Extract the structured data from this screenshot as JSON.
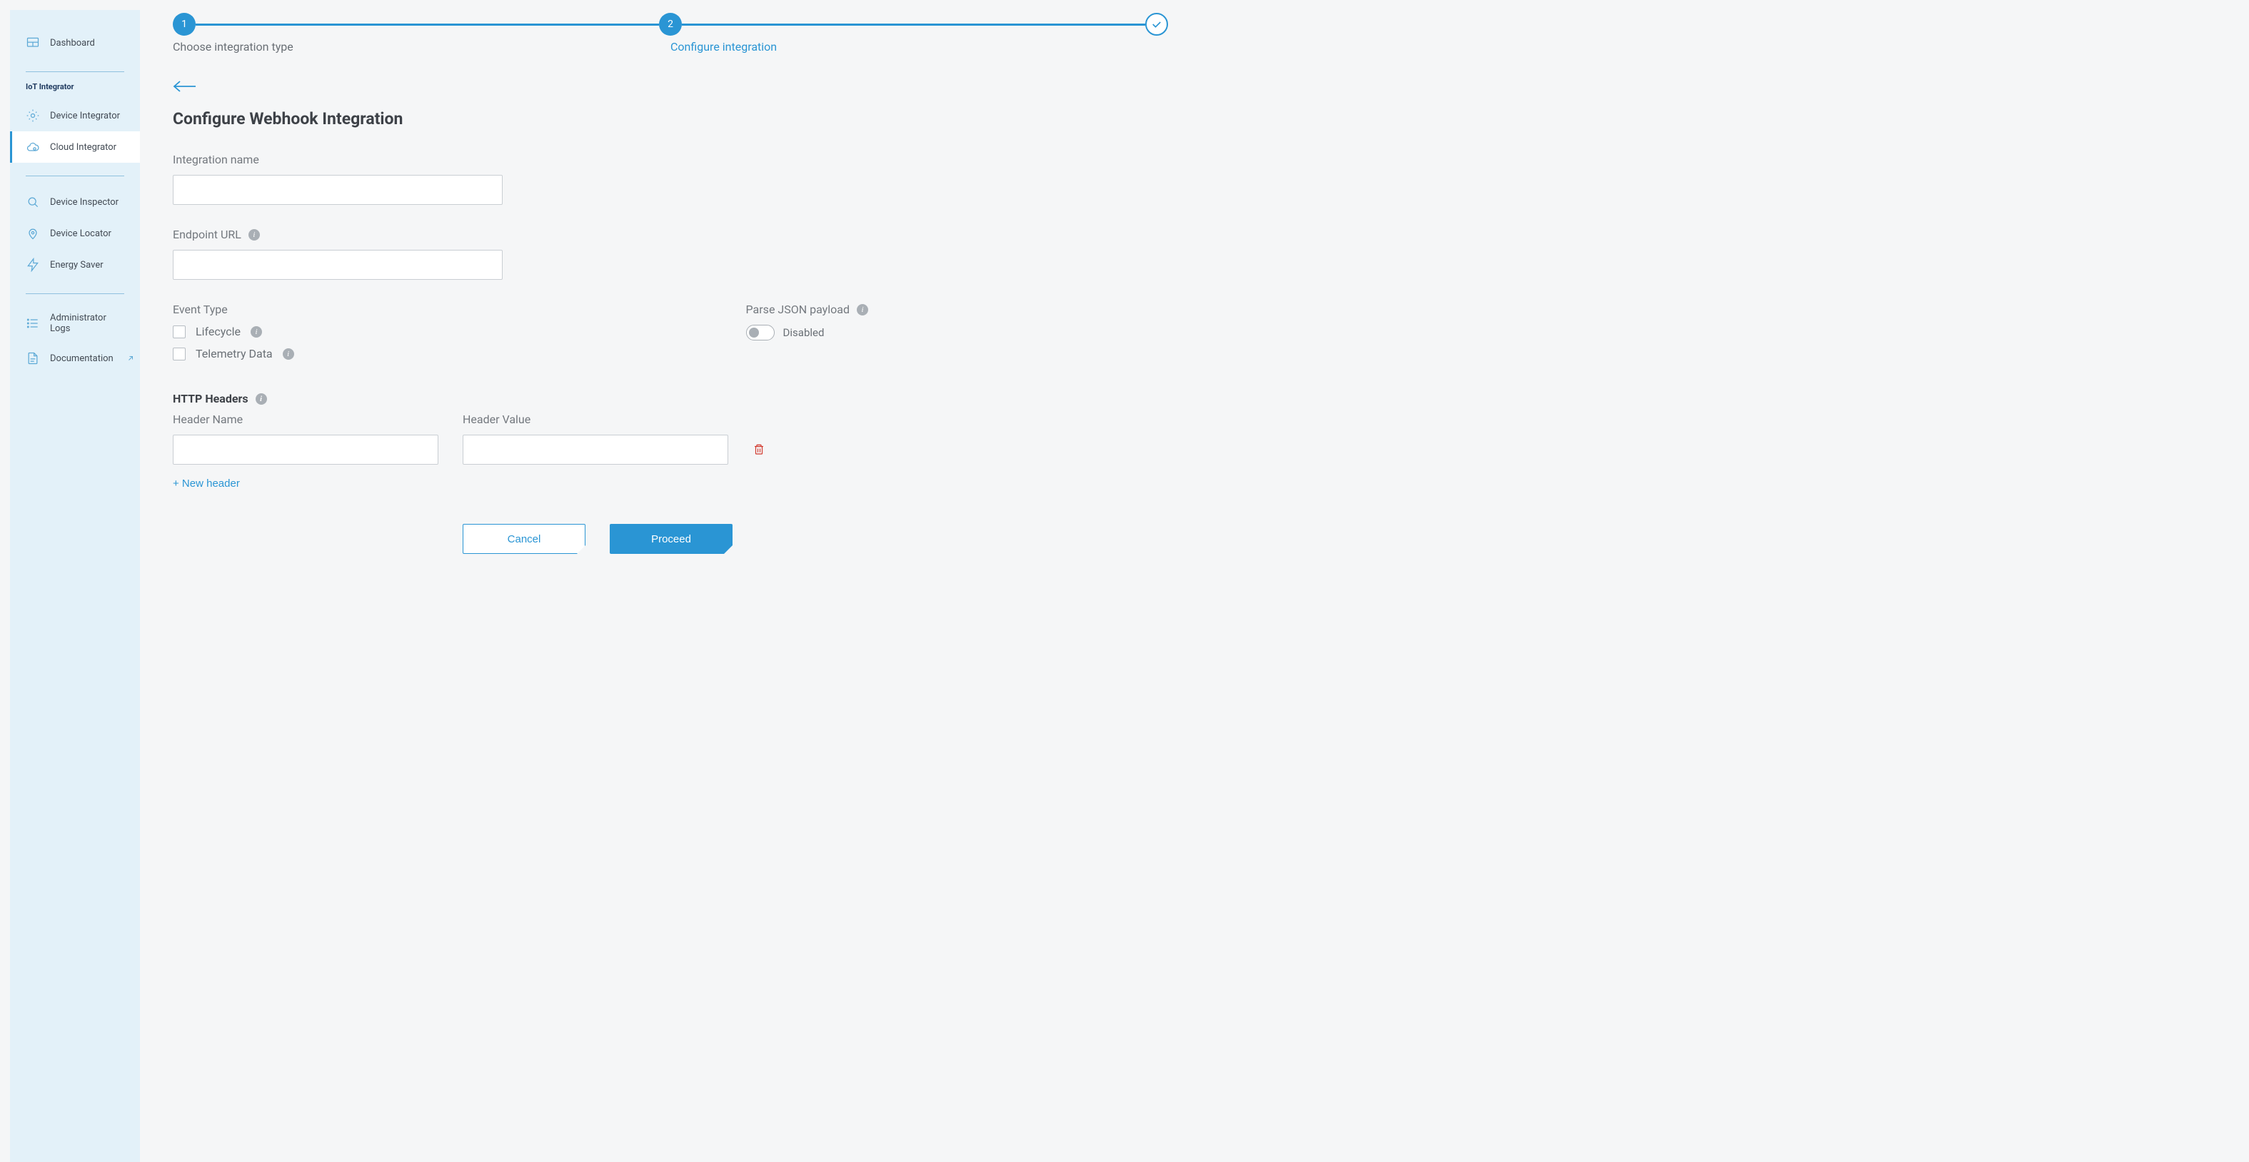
{
  "sidebar": {
    "dashboard": "Dashboard",
    "section_title": "IoT Integrator",
    "device_integrator": "Device Integrator",
    "cloud_integrator": "Cloud Integrator",
    "device_inspector": "Device Inspector",
    "device_locator": "Device Locator",
    "energy_saver": "Energy Saver",
    "admin_logs": "Administrator Logs",
    "documentation": "Documentation"
  },
  "stepper": {
    "step1_number": "1",
    "step2_number": "2",
    "step1_label": "Choose integration type",
    "step2_label": "Configure integration"
  },
  "page": {
    "title": "Configure Webhook Integration"
  },
  "fields": {
    "integration_name_label": "Integration name",
    "integration_name_value": "",
    "endpoint_url_label": "Endpoint URL",
    "endpoint_url_value": "",
    "event_type_label": "Event Type",
    "event_lifecycle": "Lifecycle",
    "event_telemetry": "Telemetry Data",
    "parse_json_label": "Parse JSON payload",
    "parse_json_state": "Disabled"
  },
  "headers": {
    "title": "HTTP Headers",
    "col_name": "Header Name",
    "col_value": "Header Value",
    "rows": [
      {
        "name": "",
        "value": ""
      }
    ],
    "new_header": "+ New header"
  },
  "actions": {
    "cancel": "Cancel",
    "proceed": "Proceed"
  }
}
